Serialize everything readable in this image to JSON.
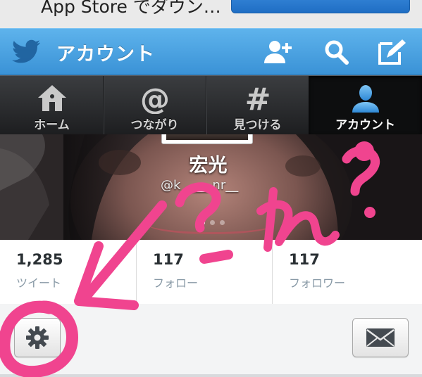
{
  "banner": {
    "text": "App Store でダウン…"
  },
  "header": {
    "title": "アカウント",
    "icons": [
      "twitter-bird-icon",
      "add-user-icon",
      "search-icon",
      "compose-icon"
    ]
  },
  "tabs": [
    {
      "label": "ホーム",
      "icon": "home-icon",
      "active": false
    },
    {
      "label": "つながり",
      "icon": "at-icon",
      "active": false
    },
    {
      "label": "見つける",
      "icon": "hash-icon",
      "active": false
    },
    {
      "label": "アカウント",
      "icon": "person-icon",
      "active": true
    }
  ],
  "profile": {
    "name": "宏光",
    "handle": "@k_____nr__"
  },
  "stats": [
    {
      "count": "1,285",
      "label": "ツイート"
    },
    {
      "count": "117",
      "label": "フォロー"
    },
    {
      "count": "117",
      "label": "フォロワー"
    }
  ],
  "actions": {
    "settings_icon": "gear-icon",
    "message_icon": "envelope-icon"
  },
  "annotation": {
    "text": "?これ?",
    "color": "#f0448f"
  },
  "colors": {
    "header_blue": "#3a92d6",
    "tabbar_dark": "#1d1e20",
    "annotation_pink": "#f0448f"
  }
}
